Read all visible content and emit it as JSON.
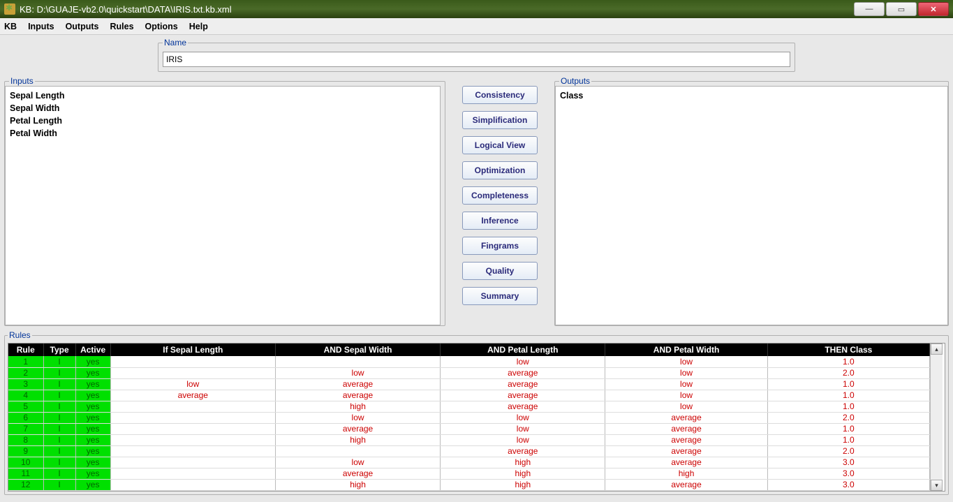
{
  "window": {
    "title": "KB: D:\\GUAJE-vb2.0\\quickstart\\DATA\\IRIS.txt.kb.xml"
  },
  "menu": {
    "kb": "KB",
    "inputs": "Inputs",
    "outputs": "Outputs",
    "rules": "Rules",
    "options": "Options",
    "help": "Help"
  },
  "name_section": {
    "legend": "Name",
    "value": "IRIS"
  },
  "inputs_section": {
    "legend": "Inputs",
    "items": [
      "Sepal Length",
      "Sepal Width",
      "Petal Length",
      "Petal Width"
    ]
  },
  "outputs_section": {
    "legend": "Outputs",
    "items": [
      "Class"
    ]
  },
  "center_buttons": [
    "Consistency",
    "Simplification",
    "Logical View",
    "Optimization",
    "Completeness",
    "Inference",
    "Fingrams",
    "Quality",
    "Summary"
  ],
  "rules_section": {
    "legend": "Rules",
    "columns": [
      "Rule",
      "Type",
      "Active",
      "If Sepal Length",
      "AND Sepal Width",
      "AND Petal Length",
      "AND Petal Width",
      "THEN Class"
    ],
    "rows": [
      {
        "rule": "1",
        "type": "I",
        "active": "yes",
        "c": [
          "",
          "",
          "low",
          "low",
          "1.0"
        ]
      },
      {
        "rule": "2",
        "type": "I",
        "active": "yes",
        "c": [
          "",
          "low",
          "average",
          "low",
          "2.0"
        ]
      },
      {
        "rule": "3",
        "type": "I",
        "active": "yes",
        "c": [
          "low",
          "average",
          "average",
          "low",
          "1.0"
        ]
      },
      {
        "rule": "4",
        "type": "I",
        "active": "yes",
        "c": [
          "average",
          "average",
          "average",
          "low",
          "1.0"
        ]
      },
      {
        "rule": "5",
        "type": "I",
        "active": "yes",
        "c": [
          "",
          "high",
          "average",
          "low",
          "1.0"
        ]
      },
      {
        "rule": "6",
        "type": "I",
        "active": "yes",
        "c": [
          "",
          "low",
          "low",
          "average",
          "2.0"
        ]
      },
      {
        "rule": "7",
        "type": "I",
        "active": "yes",
        "c": [
          "",
          "average",
          "low",
          "average",
          "1.0"
        ]
      },
      {
        "rule": "8",
        "type": "I",
        "active": "yes",
        "c": [
          "",
          "high",
          "low",
          "average",
          "1.0"
        ]
      },
      {
        "rule": "9",
        "type": "I",
        "active": "yes",
        "c": [
          "",
          "",
          "average",
          "average",
          "2.0"
        ]
      },
      {
        "rule": "10",
        "type": "I",
        "active": "yes",
        "c": [
          "",
          "low",
          "high",
          "average",
          "3.0"
        ]
      },
      {
        "rule": "11",
        "type": "I",
        "active": "yes",
        "c": [
          "",
          "average",
          "high",
          "high",
          "3.0"
        ]
      },
      {
        "rule": "12",
        "type": "I",
        "active": "yes",
        "c": [
          "",
          "high",
          "high",
          "average",
          "3.0"
        ]
      }
    ]
  }
}
